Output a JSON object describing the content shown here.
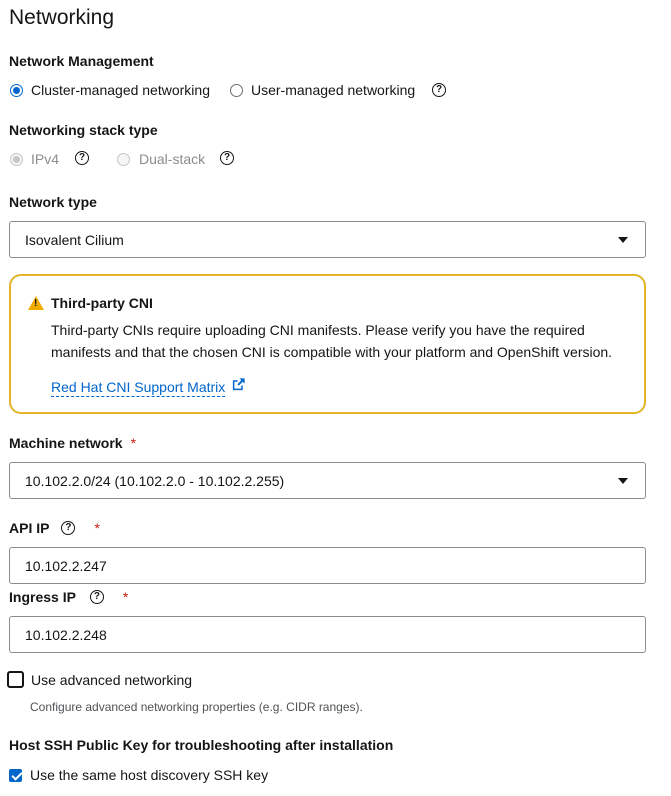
{
  "page": {
    "title": "Networking"
  },
  "network_management": {
    "label": "Network Management",
    "options": [
      {
        "label": "Cluster-managed networking",
        "selected": true
      },
      {
        "label": "User-managed networking",
        "selected": false
      }
    ]
  },
  "stack_type": {
    "label": "Networking stack type",
    "options": [
      {
        "label": "IPv4",
        "selected": true,
        "disabled": true
      },
      {
        "label": "Dual-stack",
        "selected": false,
        "disabled": true
      }
    ]
  },
  "network_type": {
    "label": "Network type",
    "value": "Isovalent Cilium"
  },
  "alert": {
    "title": "Third-party CNI",
    "body": "Third-party CNIs require uploading CNI manifests. Please verify you have the required manifests and that the chosen CNI is compatible with your platform and OpenShift version.",
    "link": "Red Hat CNI Support Matrix"
  },
  "machine_network": {
    "label": "Machine network",
    "required_mark": "*",
    "value": "10.102.2.0/24 (10.102.2.0 - 10.102.2.255)"
  },
  "api_ip": {
    "label": "API IP",
    "required_mark": "*",
    "value": "10.102.2.247"
  },
  "ingress_ip": {
    "label": "Ingress IP",
    "required_mark": "*",
    "value": "10.102.2.248"
  },
  "advanced": {
    "label": "Use advanced networking",
    "checked": false,
    "helper": "Configure advanced networking properties (e.g. CIDR ranges)."
  },
  "ssh": {
    "label": "Host SSH Public Key for troubleshooting after installation",
    "checkbox_label": "Use the same host discovery SSH key",
    "checked": true
  },
  "colors": {
    "accent": "#0066cc",
    "warning": "#f0ab00",
    "required": "#c9190b"
  }
}
